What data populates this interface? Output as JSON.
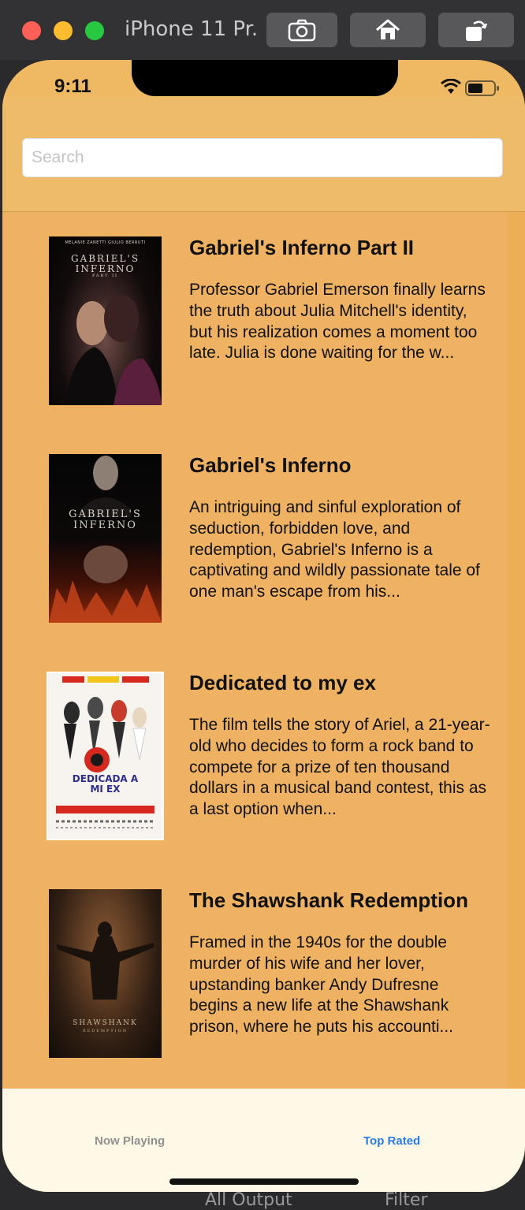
{
  "simulator": {
    "title": "iPhone 11 Pr...",
    "buttons": [
      "screenshot",
      "home",
      "rotate"
    ],
    "under_text": "All Output",
    "under_text2": "Filter"
  },
  "status_bar": {
    "time": "9:11"
  },
  "search": {
    "placeholder": "Search",
    "value": ""
  },
  "movies": [
    {
      "title": "Gabriel's Inferno Part II",
      "overview": "Professor Gabriel Emerson finally learns the truth about Julia Mitchell's identity, but his realization comes a moment too late. Julia is done waiting for the w...",
      "poster_credits": "MELANIE ZANETTI     GIULIO BERRUTI",
      "poster_title": "GABRIEL'S INFERNO",
      "poster_sub": "PART II"
    },
    {
      "title": "Gabriel's Inferno",
      "overview": "An intriguing and sinful exploration of seduction, forbidden love, and redemption, Gabriel's Inferno is a captivating and wildly passionate tale of one man's escape from his...",
      "poster_title": "GABRIEL'S INFERNO"
    },
    {
      "title": "Dedicated to my ex",
      "overview": "The film tells the story of Ariel, a 21-year-old who decides to form a rock band to compete for a prize of ten thousand dollars in a musical band contest, this as a last option when...",
      "poster_title": "DEDICADA A MI EX"
    },
    {
      "title": "The Shawshank Redemption",
      "overview": "Framed in the 1940s for the double murder of his wife and her lover, upstanding banker Andy Dufresne begins a new life at the Shawshank prison, where he puts his accounti...",
      "poster_title": "SHAWSHANK",
      "poster_sub": "REDEMPTION"
    }
  ],
  "tabs": [
    {
      "label": "Now Playing",
      "selected": false
    },
    {
      "label": "Top Rated",
      "selected": true
    }
  ],
  "colors": {
    "nav": "#eebb68",
    "list_bg": "#efb262",
    "tab_bar": "#fef9e6",
    "tab_selected": "#2b7be5",
    "tab_unselected": "#909090"
  }
}
